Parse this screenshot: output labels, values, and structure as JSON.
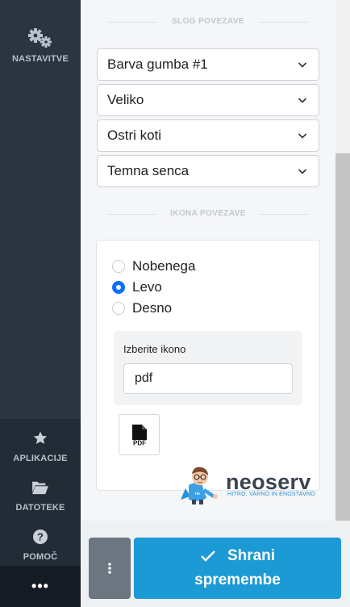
{
  "sidebar": {
    "settings_label": "NASTAVITVE",
    "apps_label": "APLIKACIJE",
    "files_label": "DATOTEKE",
    "help_label": "POMOČ",
    "more_label": "•••"
  },
  "button_style_section": {
    "title": "SLOG POVEZAVE",
    "selects": {
      "color": "Barva gumba #1",
      "size": "Veliko",
      "corners": "Ostri koti",
      "shadow": "Temna senca"
    }
  },
  "link_icon_section": {
    "title": "IKONA POVEZAVE",
    "radios": {
      "none": "Nobenega",
      "left": "Levo",
      "right": "Desno"
    },
    "selected_radio": "Levo",
    "icon_label": "Izberite ikono",
    "icon_value": "pdf",
    "preview_text": "PDF"
  },
  "watermark": {
    "brand": "neoserv",
    "tagline": "HITRO, VARNO IN ENOSTAVNO"
  },
  "footer": {
    "save_line1": "Shrani",
    "save_line2": "spremembe"
  },
  "colors": {
    "accent": "#1b9ad6",
    "radio_selected": "#0d6efd",
    "sidebar": "#2a3541"
  }
}
